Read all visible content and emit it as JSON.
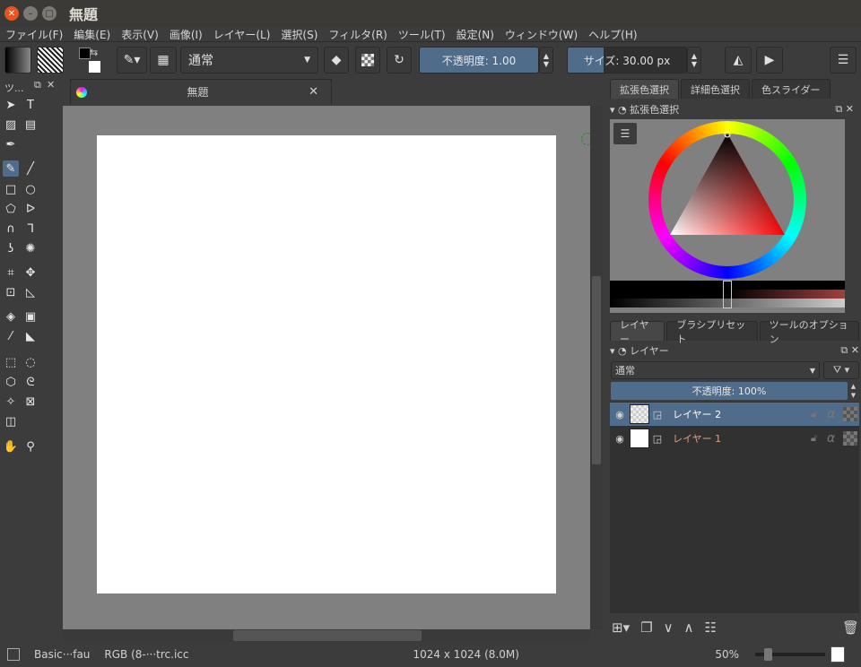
{
  "window": {
    "title": "無題"
  },
  "menu": [
    "ファイル(F)",
    "編集(E)",
    "表示(V)",
    "画像(I)",
    "レイヤー(L)",
    "選択(S)",
    "フィルタ(R)",
    "ツール(T)",
    "設定(N)",
    "ウィンドウ(W)",
    "ヘルプ(H)"
  ],
  "toolbar": {
    "blend_mode": "通常",
    "opacity": "不透明度: 1.00",
    "size": "サイズ: 30.00 px",
    "size_fraction": 0.3
  },
  "toolbox": {
    "title": "ツ..."
  },
  "document": {
    "tab_title": "無題"
  },
  "color_dock": {
    "tabs": [
      "拡張色選択",
      "詳細色選択",
      "色スライダー"
    ],
    "title": "拡張色選択",
    "fg_color": "#000000",
    "hue_color": "#ff0000"
  },
  "layer_dock": {
    "tabs": [
      "レイヤー",
      "ブラシプリセット",
      "ツールのオプション"
    ],
    "title": "レイヤー",
    "blend_mode": "通常",
    "opacity": "不透明度: 100%",
    "layers": [
      {
        "name": "レイヤー 2",
        "selected": true
      },
      {
        "name": "レイヤー 1",
        "selected": false
      }
    ]
  },
  "status": {
    "brush": "Basic···fau",
    "color_profile": "RGB (8-···trc.icc",
    "image_size": "1024 x 1024 (8.0M)",
    "zoom": "50%"
  },
  "colors": {
    "accent": "#4f6d8a",
    "canvas_bg": "#808080"
  }
}
